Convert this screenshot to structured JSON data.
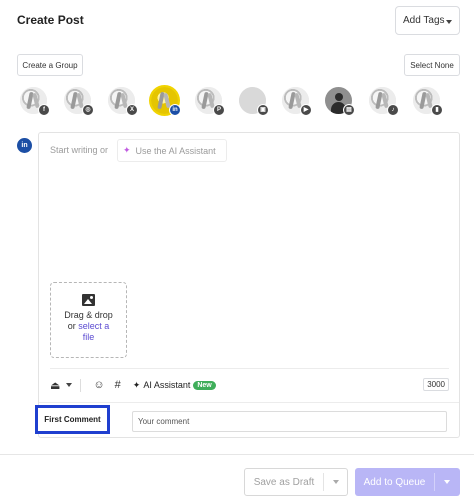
{
  "header": {
    "title": "Create Post",
    "add_tags_label": "Add Tags"
  },
  "actions": {
    "create_group": "Create a Group",
    "select_none": "Select None"
  },
  "accounts": [
    {
      "network": "facebook",
      "badge": "f"
    },
    {
      "network": "instagram",
      "badge": "◎"
    },
    {
      "network": "x",
      "badge": "X"
    },
    {
      "network": "linkedin",
      "badge": "in",
      "selected": true
    },
    {
      "network": "pinterest",
      "badge": "P"
    },
    {
      "network": "google-business",
      "badge": "▣"
    },
    {
      "network": "youtube",
      "badge": "▶"
    },
    {
      "network": "tiktok-business",
      "badge": "▤"
    },
    {
      "network": "tiktok",
      "badge": "♪"
    },
    {
      "network": "threads",
      "badge": "▮"
    }
  ],
  "composer": {
    "network_badge": "in",
    "prompt": "Start writing or",
    "ai_link_label": "Use the AI Assistant",
    "dropzone": {
      "line1": "Drag & drop",
      "line2_prefix": "or",
      "line2_link": "select a",
      "line3_link": "file"
    },
    "toolbar": {
      "ai_assistant_label": "AI Assistant",
      "new_badge": "New",
      "char_count": "3000"
    }
  },
  "first_comment": {
    "label": "First Comment",
    "placeholder": "Your comment"
  },
  "footer": {
    "save_draft_label": "Save as Draft",
    "add_to_queue_label": "Add to Queue"
  },
  "colors": {
    "accent": "#5b4bd1",
    "queue_button": "#b9b6f6",
    "highlight_box": "#1f3fcf",
    "linkedin": "#1c4fa5",
    "new_badge": "#3fae5a"
  }
}
